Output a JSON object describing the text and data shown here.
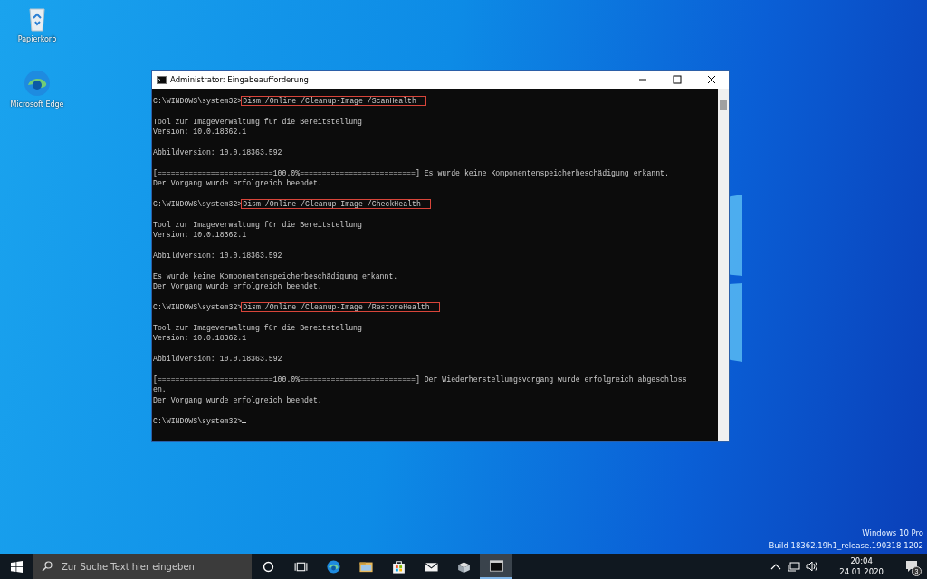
{
  "desktop": {
    "icons": [
      {
        "kind": "recycle-bin",
        "label": "Papierkorb"
      },
      {
        "kind": "edge",
        "label": "Microsoft Edge"
      }
    ],
    "watermark_lines": [
      "Windows 10 Pro",
      "Build 18362.19h1_release.190318-1202"
    ]
  },
  "window": {
    "title": "Administrator: Eingabeaufforderung",
    "lines": [
      {
        "kind": "prompt",
        "prompt": "C:\\WINDOWS\\system32>",
        "command": "Dism /Online /Cleanup-Image /ScanHealth",
        "highlighted": true
      },
      {
        "kind": "blank"
      },
      {
        "kind": "text",
        "text": "Tool zur Imageverwaltung für die Bereitstellung"
      },
      {
        "kind": "text",
        "text": "Version: 10.0.18362.1"
      },
      {
        "kind": "blank"
      },
      {
        "kind": "text",
        "text": "Abbildversion: 10.0.18363.592"
      },
      {
        "kind": "blank"
      },
      {
        "kind": "text",
        "text": "[==========================100.0%==========================] Es wurde keine Komponentenspeicherbeschädigung erkannt."
      },
      {
        "kind": "text",
        "text": "Der Vorgang wurde erfolgreich beendet."
      },
      {
        "kind": "blank"
      },
      {
        "kind": "prompt",
        "prompt": "C:\\WINDOWS\\system32>",
        "command": "Dism /Online /Cleanup-Image /CheckHealth",
        "highlighted": true
      },
      {
        "kind": "blank"
      },
      {
        "kind": "text",
        "text": "Tool zur Imageverwaltung für die Bereitstellung"
      },
      {
        "kind": "text",
        "text": "Version: 10.0.18362.1"
      },
      {
        "kind": "blank"
      },
      {
        "kind": "text",
        "text": "Abbildversion: 10.0.18363.592"
      },
      {
        "kind": "blank"
      },
      {
        "kind": "text",
        "text": "Es wurde keine Komponentenspeicherbeschädigung erkannt."
      },
      {
        "kind": "text",
        "text": "Der Vorgang wurde erfolgreich beendet."
      },
      {
        "kind": "blank"
      },
      {
        "kind": "prompt",
        "prompt": "C:\\WINDOWS\\system32>",
        "command": "Dism /Online /Cleanup-Image /RestoreHealth",
        "highlighted": true
      },
      {
        "kind": "blank"
      },
      {
        "kind": "text",
        "text": "Tool zur Imageverwaltung für die Bereitstellung"
      },
      {
        "kind": "text",
        "text": "Version: 10.0.18362.1"
      },
      {
        "kind": "blank"
      },
      {
        "kind": "text",
        "text": "Abbildversion: 10.0.18363.592"
      },
      {
        "kind": "blank"
      },
      {
        "kind": "text",
        "text": "[==========================100.0%==========================] Der Wiederherstellungsvorgang wurde erfolgreich abgeschloss"
      },
      {
        "kind": "text",
        "text": "en."
      },
      {
        "kind": "text",
        "text": "Der Vorgang wurde erfolgreich beendet."
      },
      {
        "kind": "blank"
      },
      {
        "kind": "prompt",
        "prompt": "C:\\WINDOWS\\system32>",
        "cursor": true
      }
    ]
  },
  "taskbar": {
    "search": {
      "placeholder": "Zur Suche Text hier eingeben"
    },
    "apps": [
      {
        "kind": "cortana",
        "active": false
      },
      {
        "kind": "task-view",
        "active": false
      },
      {
        "kind": "edge",
        "active": false
      },
      {
        "kind": "explorer",
        "active": false
      },
      {
        "kind": "store",
        "active": false
      },
      {
        "kind": "mail",
        "active": false
      },
      {
        "kind": "box",
        "active": false
      },
      {
        "kind": "console",
        "active": true
      }
    ],
    "tray": {
      "time": "20:04",
      "date": "24.01.2020",
      "notifications": "3"
    }
  }
}
